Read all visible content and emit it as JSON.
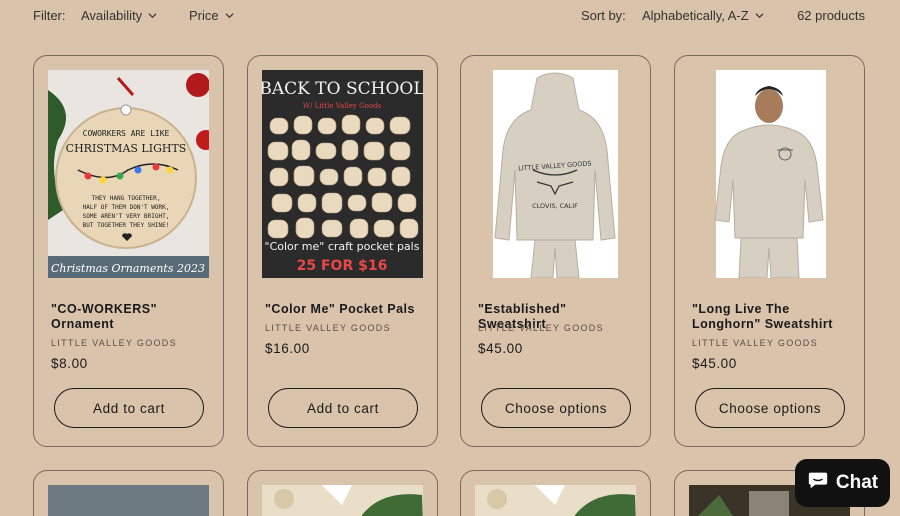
{
  "filter": {
    "label": "Filter:",
    "availability": "Availability",
    "price": "Price",
    "sort_label": "Sort by:",
    "sort_value": "Alphabetically, A-Z",
    "count": "62 products"
  },
  "products": [
    {
      "title": "\"CO-WORKERS\" Ornament",
      "vendor": "LITTLE VALLEY GOODS",
      "price": "$8.00",
      "button": "Add to cart",
      "image_text": {
        "line1": "COWORKERS ARE LIKE",
        "line2": "CHRISTMAS LIGHTS",
        "line3": "THEY HANG TOGETHER,",
        "line4": "HALF OF THEM DON'T WORK,",
        "line5": "SOME AREN'T VERY BRIGHT,",
        "line6": "BUT TOGETHER THEY SHINE!",
        "banner": "Christmas Ornaments 2023"
      }
    },
    {
      "title": "\"Color Me\" Pocket Pals",
      "vendor": "LITTLE VALLEY GOODS",
      "price": "$16.00",
      "button": "Add to cart",
      "image_text": {
        "heading": "BACK TO SCHOOL",
        "sub": "W/ Little Valley Goods",
        "caption": "\"Color me\" craft pocket pals",
        "deal": "25 FOR $16"
      }
    },
    {
      "title": "\"Established\" Sweatshirt",
      "vendor": "LITTLE VALLEY GOODS",
      "price": "$45.00",
      "button": "Choose options",
      "image_text": {
        "arc": "LITTLE VALLEY GOODS",
        "place": "CLOVIS, CALIF"
      }
    },
    {
      "title": "\"Long Live The Longhorn\" Sweatshirt",
      "vendor": "LITTLE VALLEY GOODS",
      "price": "$45.00",
      "button": "Choose options",
      "image_text": {}
    }
  ],
  "chat": {
    "label": "Chat",
    "icon": "chat-bubble-icon"
  },
  "colors": {
    "background": "#d9c3ab",
    "button_border": "#1a1a1a",
    "chat_bg": "#111111"
  }
}
